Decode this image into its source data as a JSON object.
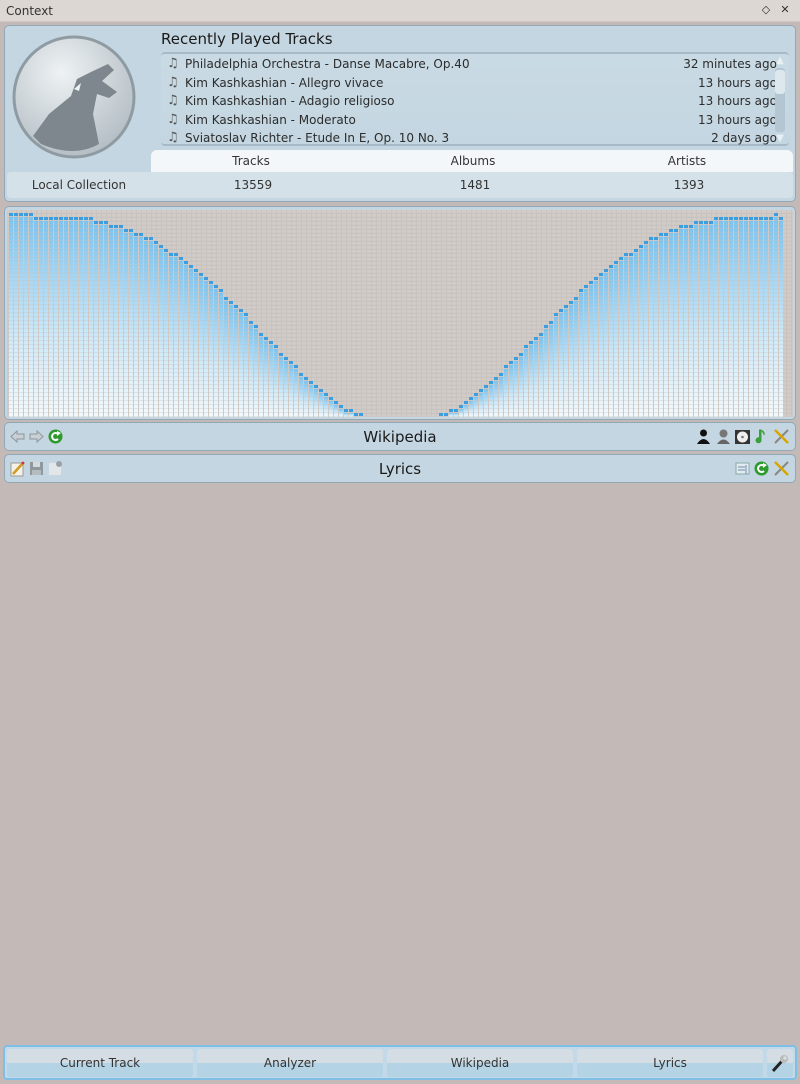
{
  "window": {
    "title": "Context",
    "buttons": [
      {
        "name": "float-button",
        "glyph": "◇"
      },
      {
        "name": "close-button",
        "glyph": "✕"
      }
    ]
  },
  "current_track": {
    "heading": "Recently Played Tracks",
    "tracks": [
      {
        "name": "Philadelphia Orchestra - Danse Macabre, Op.40",
        "when": "32 minutes ago"
      },
      {
        "name": "Kim Kashkashian - Allegro vivace",
        "when": "13 hours ago"
      },
      {
        "name": "Kim Kashkashian - Adagio religioso",
        "when": "13 hours ago"
      },
      {
        "name": "Kim Kashkashian - Moderato",
        "when": "13 hours ago"
      },
      {
        "name": "Sviatoslav Richter - Etude In E, Op. 10 No. 3",
        "when": "2 days ago"
      }
    ],
    "scroll_fraction_visible": 0.3,
    "stats": {
      "row_label": "Local Collection",
      "headers": [
        "Tracks",
        "Albums",
        "Artists"
      ],
      "values": [
        "13559",
        "1481",
        "1393"
      ]
    }
  },
  "analyzer": {
    "bar_color": "#3a9ee0",
    "fill_color": "#e6f3fb",
    "levels": [
      1.0,
      1.0,
      1.0,
      1.0,
      1.0,
      0.99,
      0.99,
      0.99,
      0.99,
      0.99,
      0.99,
      0.99,
      0.99,
      0.99,
      0.98,
      0.98,
      0.98,
      0.97,
      0.97,
      0.96,
      0.95,
      0.95,
      0.94,
      0.93,
      0.92,
      0.91,
      0.9,
      0.89,
      0.88,
      0.86,
      0.85,
      0.83,
      0.81,
      0.8,
      0.78,
      0.76,
      0.74,
      0.72,
      0.7,
      0.68,
      0.66,
      0.64,
      0.62,
      0.59,
      0.57,
      0.55,
      0.52,
      0.5,
      0.47,
      0.45,
      0.42,
      0.4,
      0.37,
      0.35,
      0.32,
      0.3,
      0.27,
      0.25,
      0.22,
      0.2,
      0.17,
      0.15,
      0.13,
      0.11,
      0.09,
      0.07,
      0.05,
      0.04,
      0.03,
      0.02,
      0.01,
      0.0,
      0.0,
      0.0,
      0.0,
      0.0,
      0.0,
      0.0,
      0.0,
      0.0,
      0.0,
      0.0,
      0.0,
      0.0,
      0.0,
      0.0,
      0.01,
      0.02,
      0.03,
      0.04,
      0.05,
      0.07,
      0.09,
      0.11,
      0.13,
      0.15,
      0.17,
      0.2,
      0.22,
      0.25,
      0.27,
      0.3,
      0.32,
      0.35,
      0.37,
      0.4,
      0.42,
      0.45,
      0.47,
      0.5,
      0.52,
      0.55,
      0.57,
      0.59,
      0.62,
      0.64,
      0.66,
      0.68,
      0.7,
      0.72,
      0.74,
      0.76,
      0.78,
      0.8,
      0.81,
      0.83,
      0.85,
      0.86,
      0.88,
      0.89,
      0.9,
      0.91,
      0.92,
      0.93,
      0.94,
      0.95,
      0.95,
      0.96,
      0.96,
      0.97,
      0.97,
      0.98,
      0.98,
      0.98,
      0.98,
      0.99,
      0.99,
      0.99,
      0.99,
      0.99,
      0.99,
      0.99,
      0.99,
      1.0,
      0.99
    ]
  },
  "wikipedia": {
    "title": "Wikipedia",
    "left_icons": [
      "back-icon",
      "forward-icon",
      "reload-icon"
    ],
    "right_icons": [
      "artist-icon",
      "composer-icon",
      "album-icon",
      "track-icon",
      "settings-icon"
    ]
  },
  "lyrics": {
    "title": "Lyrics",
    "left_icons": [
      "edit-icon",
      "save-icon",
      "close-edit-icon"
    ],
    "right_icons": [
      "scroll-icon",
      "reload-icon",
      "settings-icon"
    ]
  },
  "bottom_tabs": [
    "Current Track",
    "Analyzer",
    "Wikipedia",
    "Lyrics"
  ],
  "bottom_config_icon": "wrench-icon"
}
